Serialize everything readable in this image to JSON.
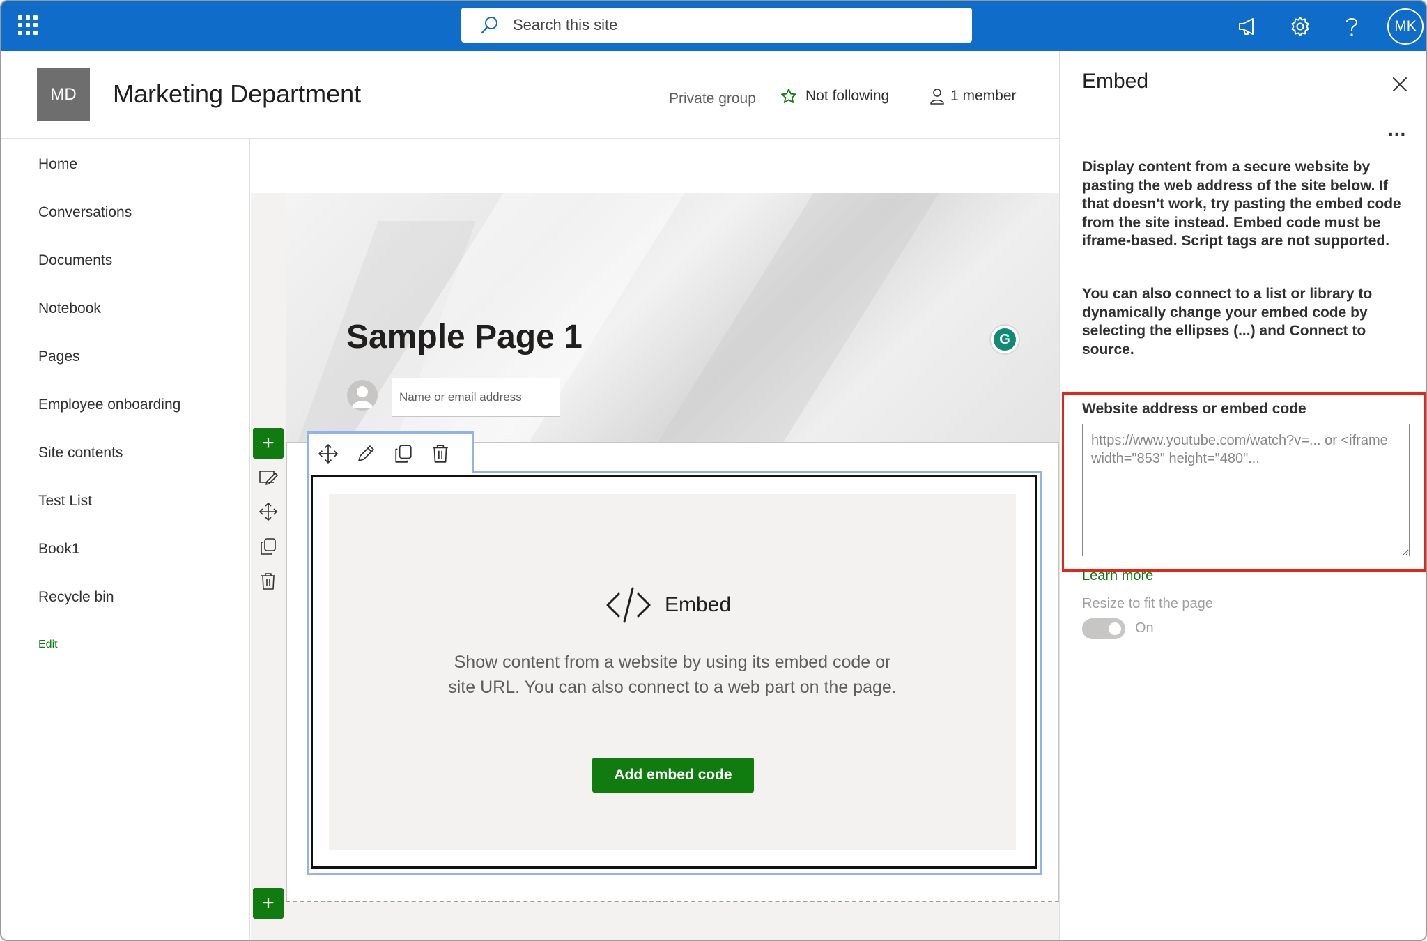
{
  "suitebar": {
    "search_placeholder": "Search this site",
    "user_initials": "MK",
    "icons": [
      "waffle-icon",
      "search-icon",
      "megaphone-icon",
      "gear-icon",
      "help-icon"
    ],
    "color": "#0f6cc9"
  },
  "site": {
    "logo_initials": "MD",
    "title": "Marketing Department",
    "privacy": "Private group",
    "follow_label": "Not following",
    "members_label": "1 member"
  },
  "nav": {
    "items": [
      {
        "label": "Home"
      },
      {
        "label": "Conversations"
      },
      {
        "label": "Documents"
      },
      {
        "label": "Notebook"
      },
      {
        "label": "Pages"
      },
      {
        "label": "Employee onboarding"
      },
      {
        "label": "Site contents"
      },
      {
        "label": "Test List"
      },
      {
        "label": "Book1"
      },
      {
        "label": "Recycle bin"
      }
    ],
    "edit_label": "Edit"
  },
  "page": {
    "title": "Sample Page 1",
    "author_placeholder": "Name or email address",
    "grammarly_letter": "G"
  },
  "webpart": {
    "name": "Embed",
    "description": "Show content from a website by using its embed code or site URL. You can also connect to a web part on the page.",
    "button_label": "Add embed code",
    "plus_symbol": "+"
  },
  "panel": {
    "title": "Embed",
    "more_label": "...",
    "paragraph1": "Display content from a secure website by pasting the web address of the site below. If that doesn't work, try pasting the embed code from the site instead. Embed code must be iframe-based. Script tags are not supported.",
    "paragraph2": "You can also connect to a list or library to dynamically change your embed code by selecting the ellipses (...) and Connect to source.",
    "field_label": "Website address or embed code",
    "field_placeholder": "https://www.youtube.com/watch?v=... or <iframe width=\"853\" height=\"480\"...",
    "learn_more": "Learn more",
    "resize_label": "Resize to fit the page",
    "toggle_label": "On",
    "toggle_on": true
  },
  "colors": {
    "accent_green": "#107c10",
    "highlight_red": "#e3261a",
    "selection_blue": "#8fb3ea"
  }
}
